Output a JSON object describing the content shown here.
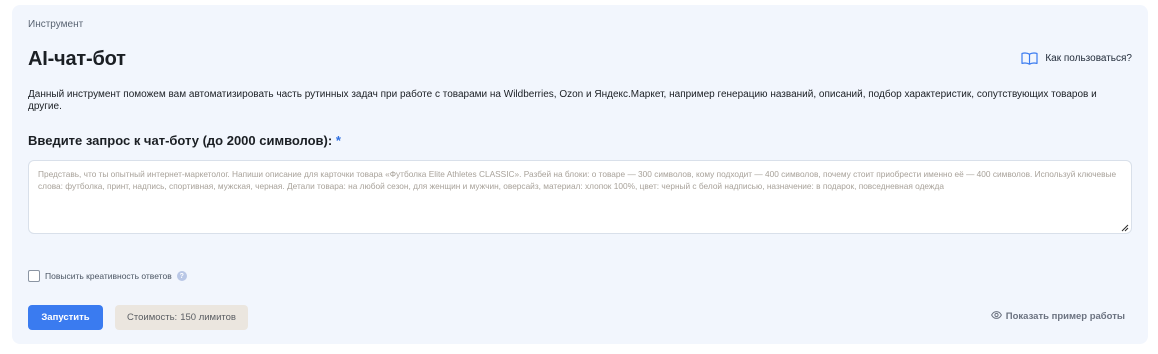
{
  "breadcrumb": "Инструмент",
  "title": "AI-чат-бот",
  "how_to_use": "Как пользоваться?",
  "description": "Данный инструмент поможем вам автоматизировать часть рутинных задач при работе с товарами на Wildberries, Ozon и Яндекс.Маркет, например генерацию названий, описаний, подбор характеристик, сопутствующих товаров и другие.",
  "prompt": {
    "label": "Введите запрос к чат-боту (до 2000 символов):",
    "required_mark": "*",
    "value": "",
    "placeholder": "Представь, что ты опытный интернет-маркетолог. Напиши описание для карточки товара «Футболка Elite Athletes CLASSIC». Разбей на блоки: о товаре — 300 символов, кому подходит — 400 символов, почему стоит приобрести именно её — 400 символов. Используй ключевые слова: футболка, принт, надпись, спортивная, мужская, черная. Детали товара: на любой сезон, для женщин и мужчин, оверсайз, материал: хлопок 100%, цвет: черный с белой надписью, назначение: в подарок, повседневная одежда"
  },
  "creativity": {
    "label": "Повысить креативность ответов",
    "checked": false,
    "help_icon": "question-icon"
  },
  "run_button": "Запустить",
  "cost": {
    "label": "Стоимость:",
    "value": "150 лимитов"
  },
  "show_example": "Показать пример работы",
  "icons": {
    "how_to": "book-icon",
    "example": "eye-icon",
    "resize": "resize-handle-icon"
  },
  "colors": {
    "accent": "#3a7bf0",
    "card_bg": "#f2f6fd",
    "cost_bg": "#ebe6df"
  }
}
